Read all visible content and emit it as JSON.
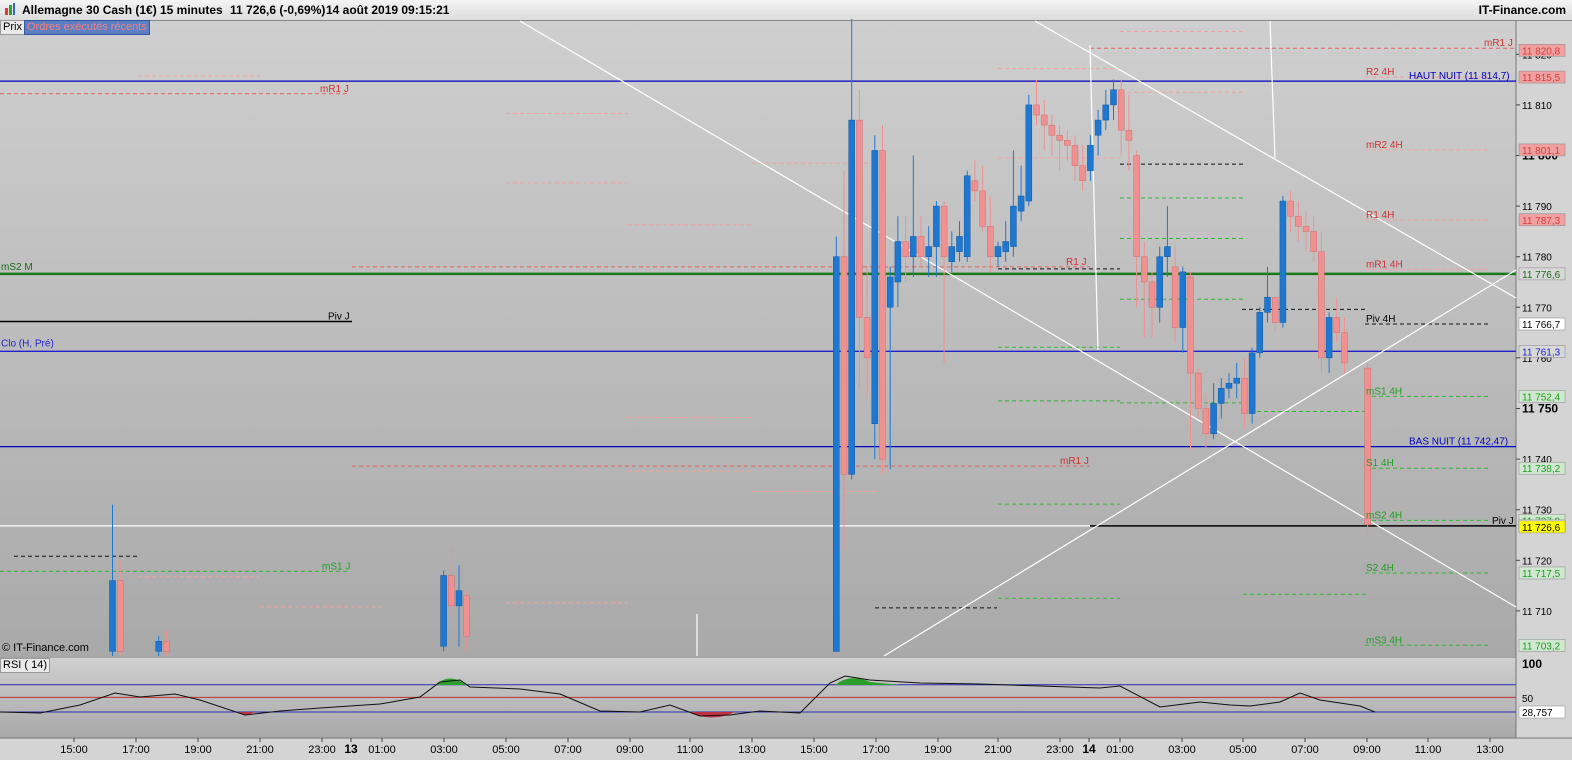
{
  "header": {
    "instrument": "Allemagne 30 Cash (1€)",
    "interval": "15 minutes",
    "quote": "11 726,6 (-0,69%)",
    "datetime": "14 août 2019 09:15:21",
    "brand": "IT-Finance.com"
  },
  "tabs": {
    "price": "Prix",
    "recent_orders": "Ordres exécutés récents"
  },
  "watermark": "© IT-Finance.com",
  "rsi_label": "RSI ( 14)",
  "colors": {
    "up": "#1e78d2",
    "down": "#f09090",
    "support": "#22aa22",
    "resistance": "#e05050",
    "night": "#0000c0",
    "pivot": "#000000",
    "last": "#ffff00"
  },
  "chart_data": {
    "type": "candlestick",
    "y_axis": {
      "range": [
        11702,
        11826
      ],
      "ticks": [
        11710,
        11720,
        11730,
        11740,
        11750,
        11760,
        11770,
        11780,
        11790,
        11800,
        11810,
        11820
      ],
      "tick_labels": [
        "11 710",
        "11 720",
        "11 730",
        "11 740",
        "11 750",
        "11 760",
        "11 770",
        "11 780",
        "11 790",
        "11 800",
        "11 810",
        "11 820"
      ],
      "bold_labels": [
        "11 750",
        "11 800"
      ]
    },
    "x_axis": {
      "labels": [
        "15:00",
        "17:00",
        "19:00",
        "21:00",
        "23:00",
        "13",
        "01:00",
        "03:00",
        "05:00",
        "07:00",
        "09:00",
        "11:00",
        "13:00",
        "15:00",
        "17:00",
        "19:00",
        "21:00",
        "23:00",
        "14",
        "01:00",
        "03:00",
        "05:00",
        "07:00",
        "09:00",
        "11:00",
        "13:00"
      ],
      "day_markers": [
        "13",
        "14"
      ]
    },
    "last_price": 11726.6,
    "price_tags": [
      {
        "label": "11 820,8",
        "value": 11820.8,
        "kind": "resistance"
      },
      {
        "label": "11 815,5",
        "value": 11815.5,
        "kind": "resistance"
      },
      {
        "label": "11 801,1",
        "value": 11801.1,
        "kind": "resistance"
      },
      {
        "label": "11 787,3",
        "value": 11787.3,
        "kind": "resistance"
      },
      {
        "label": "11 776,6",
        "value": 11776.6,
        "kind": "ms2m"
      },
      {
        "label": "11 766,7",
        "value": 11766.7,
        "kind": "pivot"
      },
      {
        "label": "11 761,3",
        "value": 11761.3,
        "kind": "night"
      },
      {
        "label": "11 752,4",
        "value": 11752.4,
        "kind": "support"
      },
      {
        "label": "11 738,2",
        "value": 11738.2,
        "kind": "support"
      },
      {
        "label": "11 727,9",
        "value": 11727.9,
        "kind": "support"
      },
      {
        "label": "11 726,8",
        "value": 11726.8,
        "kind": "pivot"
      },
      {
        "label": "11 726,6",
        "value": 11726.6,
        "kind": "last"
      },
      {
        "label": "11 717,5",
        "value": 11717.5,
        "kind": "support"
      },
      {
        "label": "11 703,2",
        "value": 11703.2,
        "kind": "support"
      }
    ],
    "horizontal_lines": [
      {
        "name": "HAUT NUIT",
        "label": "HAUT NUIT (11 814,7)",
        "value": 11814.7,
        "color": "#0000c0"
      },
      {
        "name": "BAS NUIT",
        "label": "BAS NUIT (11 742,47)",
        "value": 11742.47,
        "color": "#0000c0"
      },
      {
        "name": "mS2 M",
        "label": "mS2 M",
        "value": 11776.6,
        "color": "#1a7a1a"
      },
      {
        "name": "Clo (H, Pré)",
        "label": "Clo (H, Pré)",
        "value": 11761.3,
        "color": "#2020d0"
      }
    ],
    "level_labels": [
      {
        "label": "mR1 J",
        "value": 11812.2,
        "kind": "resistance"
      },
      {
        "label": "Piv J",
        "value": 11767.2,
        "kind": "pivot"
      },
      {
        "label": "mS1 J",
        "value": 11717.8,
        "kind": "support"
      },
      {
        "label": "R1 J",
        "value": 11778.0,
        "kind": "resistance"
      },
      {
        "label": "mR1 J",
        "value": 11738.6,
        "kind": "resistance"
      },
      {
        "label": "mR1 J",
        "value": 11821.2,
        "kind": "resistance"
      },
      {
        "label": "R2 4H",
        "value": 11815.5,
        "kind": "resistance"
      },
      {
        "label": "mR2 4H",
        "value": 11801.1,
        "kind": "resistance"
      },
      {
        "label": "R1 4H",
        "value": 11787.3,
        "kind": "resistance"
      },
      {
        "label": "mR1 4H",
        "value": 11777.5,
        "kind": "resistance"
      },
      {
        "label": "Piv 4H",
        "value": 11766.7,
        "kind": "pivot"
      },
      {
        "label": "mS1 4H",
        "value": 11752.4,
        "kind": "support"
      },
      {
        "label": "S1 4H",
        "value": 11738.2,
        "kind": "support"
      },
      {
        "label": "mS2 4H",
        "value": 11727.9,
        "kind": "support"
      },
      {
        "label": "Piv J",
        "value": 11726.8,
        "kind": "pivot"
      },
      {
        "label": "S2 4H",
        "value": 11717.5,
        "kind": "support"
      },
      {
        "label": "mS3 4H",
        "value": 11703.2,
        "kind": "support"
      }
    ],
    "candles": [
      {
        "t": "16:15",
        "o": 11702,
        "h": 11731,
        "l": 11700,
        "c": 11716
      },
      {
        "t": "16:30",
        "o": 11716,
        "h": 11720,
        "l": 11700,
        "c": 11702
      },
      {
        "t": "17:45",
        "o": 11702,
        "h": 11705,
        "l": 11700,
        "c": 11704
      },
      {
        "t": "18:00",
        "o": 11704,
        "h": 11706,
        "l": 11700,
        "c": 11702
      },
      {
        "t": "03:00",
        "o": 11703,
        "h": 11718,
        "l": 11702,
        "c": 11717
      },
      {
        "t": "03:15",
        "o": 11717,
        "h": 11723,
        "l": 11708,
        "c": 11711
      },
      {
        "t": "03:30",
        "o": 11711,
        "h": 11719,
        "l": 11703,
        "c": 11714
      },
      {
        "t": "03:45",
        "o": 11713,
        "h": 11714,
        "l": 11702,
        "c": 11705
      },
      {
        "t": "15:45",
        "o": 11702,
        "h": 11784,
        "l": 11702,
        "c": 11780
      },
      {
        "t": "16:00",
        "o": 11780,
        "h": 11797,
        "l": 11722,
        "c": 11737
      },
      {
        "t": "16:15",
        "o": 11737,
        "h": 11827,
        "l": 11736,
        "c": 11807
      },
      {
        "t": "16:30",
        "o": 11807,
        "h": 11813,
        "l": 11754,
        "c": 11768
      },
      {
        "t": "16:45",
        "o": 11768,
        "h": 11778,
        "l": 11752,
        "c": 11760
      },
      {
        "t": "17:00",
        "o": 11747,
        "h": 11804,
        "l": 11740,
        "c": 11801
      },
      {
        "t": "17:15",
        "o": 11801,
        "h": 11806,
        "l": 11737,
        "c": 11740
      },
      {
        "t": "17:30",
        "o": 11770,
        "h": 11778,
        "l": 11738,
        "c": 11776
      },
      {
        "t": "17:45",
        "o": 11775,
        "h": 11788,
        "l": 11770,
        "c": 11783
      },
      {
        "t": "18:00",
        "o": 11783,
        "h": 11788,
        "l": 11775,
        "c": 11780
      },
      {
        "t": "18:15",
        "o": 11780,
        "h": 11800,
        "l": 11776,
        "c": 11784
      },
      {
        "t": "18:30",
        "o": 11784,
        "h": 11788,
        "l": 11778,
        "c": 11780
      },
      {
        "t": "18:45",
        "o": 11780,
        "h": 11786,
        "l": 11776,
        "c": 11782
      },
      {
        "t": "19:00",
        "o": 11782,
        "h": 11791,
        "l": 11776,
        "c": 11790
      },
      {
        "t": "19:15",
        "o": 11790,
        "h": 11791,
        "l": 11759,
        "c": 11780
      },
      {
        "t": "19:30",
        "o": 11779,
        "h": 11785,
        "l": 11777,
        "c": 11782
      },
      {
        "t": "19:45",
        "o": 11781,
        "h": 11787,
        "l": 11779,
        "c": 11784
      },
      {
        "t": "20:00",
        "o": 11780,
        "h": 11797,
        "l": 11779,
        "c": 11796
      },
      {
        "t": "20:15",
        "o": 11795,
        "h": 11799,
        "l": 11791,
        "c": 11793
      },
      {
        "t": "20:30",
        "o": 11793,
        "h": 11798,
        "l": 11785,
        "c": 11786
      },
      {
        "t": "20:45",
        "o": 11786,
        "h": 11792,
        "l": 11777,
        "c": 11780
      },
      {
        "t": "21:00",
        "o": 11780,
        "h": 11783,
        "l": 11778,
        "c": 11782
      },
      {
        "t": "21:15",
        "o": 11781,
        "h": 11787,
        "l": 11779,
        "c": 11783
      },
      {
        "t": "21:30",
        "o": 11782,
        "h": 11801,
        "l": 11780,
        "c": 11790
      },
      {
        "t": "21:45",
        "o": 11789,
        "h": 11798,
        "l": 11787,
        "c": 11792
      },
      {
        "t": "22:00",
        "o": 11791,
        "h": 11812,
        "l": 11790,
        "c": 11810
      },
      {
        "t": "22:15",
        "o": 11810,
        "h": 11815,
        "l": 11806,
        "c": 11808
      },
      {
        "t": "22:30",
        "o": 11808,
        "h": 11811,
        "l": 11801,
        "c": 11806
      },
      {
        "t": "22:45",
        "o": 11806,
        "h": 11808,
        "l": 11800,
        "c": 11804
      },
      {
        "t": "23:00",
        "o": 11804,
        "h": 11806,
        "l": 11797,
        "c": 11803
      },
      {
        "t": "23:15",
        "o": 11803,
        "h": 11805,
        "l": 11799,
        "c": 11802
      },
      {
        "t": "23:30",
        "o": 11802,
        "h": 11804,
        "l": 11795,
        "c": 11798
      },
      {
        "t": "23:45",
        "o": 11798,
        "h": 11802,
        "l": 11793,
        "c": 11795
      },
      {
        "t": "00:00",
        "o": 11797,
        "h": 11804,
        "l": 11795,
        "c": 11802
      },
      {
        "t": "00:15",
        "o": 11804,
        "h": 11809,
        "l": 11800,
        "c": 11807
      },
      {
        "t": "00:30",
        "o": 11807,
        "h": 11813,
        "l": 11805,
        "c": 11810
      },
      {
        "t": "00:45",
        "o": 11810,
        "h": 11815,
        "l": 11807,
        "c": 11813
      },
      {
        "t": "01:00",
        "o": 11813,
        "h": 11815,
        "l": 11800,
        "c": 11805
      },
      {
        "t": "01:15",
        "o": 11805,
        "h": 11812,
        "l": 11797,
        "c": 11803
      },
      {
        "t": "01:30",
        "o": 11800,
        "h": 11801,
        "l": 11770,
        "c": 11780
      },
      {
        "t": "01:45",
        "o": 11780,
        "h": 11783,
        "l": 11764,
        "c": 11775
      },
      {
        "t": "02:00",
        "o": 11775,
        "h": 11777,
        "l": 11764,
        "c": 11770
      },
      {
        "t": "02:15",
        "o": 11770,
        "h": 11782,
        "l": 11767,
        "c": 11780
      },
      {
        "t": "02:30",
        "o": 11780,
        "h": 11790,
        "l": 11776,
        "c": 11782
      },
      {
        "t": "02:45",
        "o": 11778,
        "h": 11782,
        "l": 11763,
        "c": 11766
      },
      {
        "t": "03:00",
        "o": 11766,
        "h": 11778,
        "l": 11761,
        "c": 11777
      },
      {
        "t": "03:15",
        "o": 11776,
        "h": 11777,
        "l": 11742,
        "c": 11757
      },
      {
        "t": "03:30",
        "o": 11757,
        "h": 11758,
        "l": 11748,
        "c": 11750
      },
      {
        "t": "03:45",
        "o": 11750,
        "h": 11753,
        "l": 11742,
        "c": 11745
      },
      {
        "t": "04:00",
        "o": 11745,
        "h": 11755,
        "l": 11744,
        "c": 11751
      },
      {
        "t": "04:15",
        "o": 11751,
        "h": 11756,
        "l": 11748,
        "c": 11754
      },
      {
        "t": "04:30",
        "o": 11754,
        "h": 11757,
        "l": 11752,
        "c": 11755
      },
      {
        "t": "04:45",
        "o": 11755,
        "h": 11759,
        "l": 11752,
        "c": 11756
      },
      {
        "t": "05:00",
        "o": 11756,
        "h": 11760,
        "l": 11746,
        "c": 11749
      },
      {
        "t": "05:15",
        "o": 11749,
        "h": 11762,
        "l": 11747,
        "c": 11761
      },
      {
        "t": "05:30",
        "o": 11761,
        "h": 11770,
        "l": 11760,
        "c": 11769
      },
      {
        "t": "05:45",
        "o": 11769,
        "h": 11778,
        "l": 11767,
        "c": 11772
      },
      {
        "t": "06:00",
        "o": 11772,
        "h": 11771,
        "l": 11765,
        "c": 11767
      },
      {
        "t": "06:15",
        "o": 11767,
        "h": 11792,
        "l": 11766,
        "c": 11791
      },
      {
        "t": "06:30",
        "o": 11791,
        "h": 11793,
        "l": 11785,
        "c": 11788
      },
      {
        "t": "06:45",
        "o": 11788,
        "h": 11791,
        "l": 11783,
        "c": 11786
      },
      {
        "t": "07:00",
        "o": 11786,
        "h": 11789,
        "l": 11781,
        "c": 11785
      },
      {
        "t": "07:15",
        "o": 11785,
        "h": 11788,
        "l": 11779,
        "c": 11781
      },
      {
        "t": "07:30",
        "o": 11781,
        "h": 11785,
        "l": 11757,
        "c": 11760
      },
      {
        "t": "07:45",
        "o": 11760,
        "h": 11769,
        "l": 11757,
        "c": 11768
      },
      {
        "t": "08:00",
        "o": 11768,
        "h": 11772,
        "l": 11763,
        "c": 11765
      },
      {
        "t": "08:15",
        "o": 11765,
        "h": 11768,
        "l": 11757,
        "c": 11759
      },
      {
        "t": "09:00",
        "o": 11758,
        "h": 11759,
        "l": 11724,
        "c": 11727
      }
    ],
    "rsi": {
      "period": 14,
      "value": 28.757,
      "value_label": "28,757",
      "axis_labels": [
        "100",
        "50"
      ],
      "levels": [
        30,
        70
      ]
    }
  }
}
